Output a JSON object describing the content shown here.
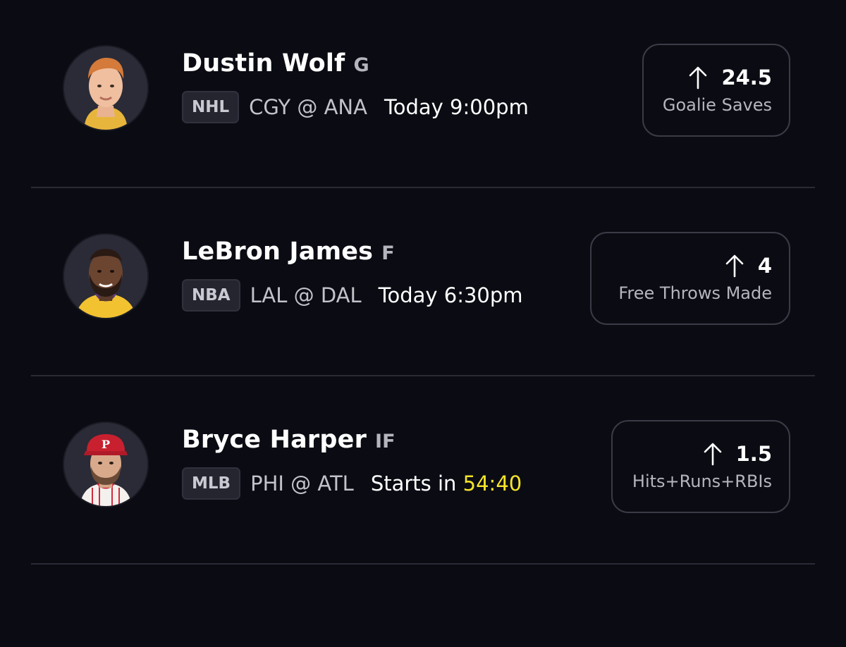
{
  "colors": {
    "background": "#0b0c13",
    "countdown": "#f5e52a",
    "divider": "#2a2b35"
  },
  "picks": [
    {
      "player": "Dustin Wolf",
      "position": "G",
      "league": "NHL",
      "matchup": "CGY @ ANA",
      "time_label": "Today 9:00pm",
      "countdown": "",
      "direction_icon": "arrow-up-icon",
      "line": "24.5",
      "stat": "Goalie Saves"
    },
    {
      "player": "LeBron James",
      "position": "F",
      "league": "NBA",
      "matchup": "LAL @ DAL",
      "time_label": "Today 6:30pm",
      "countdown": "",
      "direction_icon": "arrow-up-icon",
      "line": "4",
      "stat": "Free Throws Made"
    },
    {
      "player": "Bryce Harper",
      "position": "IF",
      "league": "MLB",
      "matchup": "PHI @ ATL",
      "time_label": "Starts in ",
      "countdown": "54:40",
      "direction_icon": "arrow-up-icon",
      "line": "1.5",
      "stat": "Hits+Runs+RBIs"
    }
  ]
}
